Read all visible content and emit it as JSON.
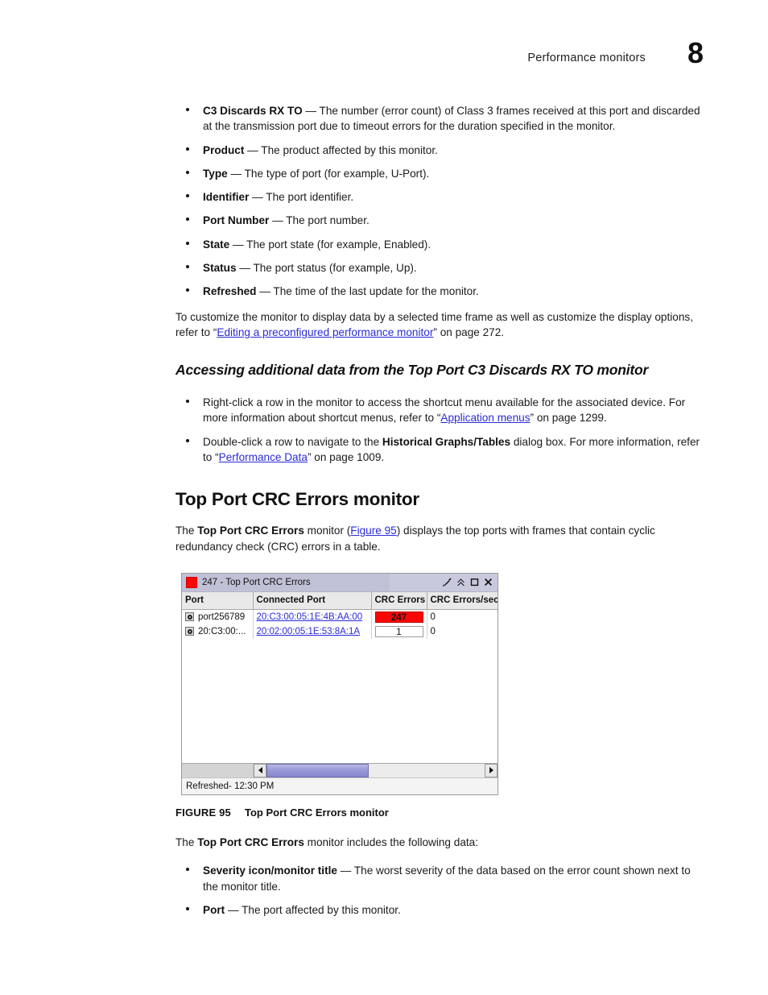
{
  "header": {
    "title": "Performance monitors",
    "page_number": "8"
  },
  "bullets_top": [
    {
      "term": "C3 Discards RX TO",
      "text": " — The number (error count) of Class 3 frames received at this port and discarded at the transmission port due to timeout errors for the duration specified in the monitor."
    },
    {
      "term": "Product",
      "text": " — The product affected by this monitor."
    },
    {
      "term": "Type",
      "text": " — The type of port (for example, U-Port)."
    },
    {
      "term": "Identifier",
      "text": " — The port identifier."
    },
    {
      "term": "Port Number",
      "text": " — The port number."
    },
    {
      "term": "State",
      "text": " — The port state (for example, Enabled)."
    },
    {
      "term": "Status",
      "text": " — The port status (for example, Up)."
    },
    {
      "term": "Refreshed",
      "text": " — The time of the last update for the monitor."
    }
  ],
  "customize_paragraph": {
    "before_link": "To customize the monitor to display data by a selected time frame as well as customize the display options, refer to “",
    "link": "Editing a preconfigured performance monitor",
    "after_link": "” on page 272."
  },
  "subheading": "Accessing additional data from the Top Port C3 Discards RX TO monitor",
  "bullets_access": [
    {
      "part1": "Right-click a row in the monitor to access the shortcut menu available for the associated device. For more information about shortcut menus, refer to “",
      "link": "Application menus",
      "part2": "” on page 1299."
    },
    {
      "part1": "Double-click a row to navigate to the ",
      "bold": "Historical Graphs/Tables",
      "part2": " dialog box. For more information, refer to “",
      "link": "Performance Data",
      "part3": "” on page 1009."
    }
  ],
  "section_heading": "Top Port CRC Errors monitor",
  "intro_paragraph": {
    "part1": "The ",
    "bold": "Top Port CRC Errors",
    "part2": " monitor (",
    "link": "Figure 95",
    "part3": ") displays the top ports with frames that contain cyclic redundancy check (CRC) errors in a table."
  },
  "figure": {
    "window": {
      "title": "247 - Top Port CRC Errors",
      "severity_color": "#fb0505",
      "icons": [
        "wrench-icon",
        "collapse-icon",
        "maximize-icon",
        "close-icon"
      ],
      "columns": [
        "Port",
        "Connected Port",
        "CRC Errors",
        "CRC Errors/sec"
      ],
      "rows": [
        {
          "port": "port256789",
          "connected_port": "20:C3:00:05:1E:4B:AA:00",
          "crc_errors": "247",
          "crc_errors_alert": true,
          "crc_errors_sec": "0"
        },
        {
          "port": "20:C3:00:...",
          "connected_port": "20:02:00:05:1E:53:8A:1A",
          "crc_errors": "1",
          "crc_errors_alert": false,
          "crc_errors_sec": "0"
        }
      ],
      "status": "Refreshed- 12:30 PM"
    },
    "caption_number": "FIGURE 95",
    "caption_title": "Top Port CRC Errors monitor"
  },
  "includes_paragraph": {
    "part1": "The ",
    "bold": "Top Port CRC Errors",
    "part2": " monitor includes the following data:"
  },
  "bullets_bottom": [
    {
      "term": "Severity icon/monitor title",
      "text": " — The worst severity of the data based on the error count shown next to the monitor title."
    },
    {
      "term": "Port",
      "text": " — The port affected by this monitor."
    }
  ]
}
